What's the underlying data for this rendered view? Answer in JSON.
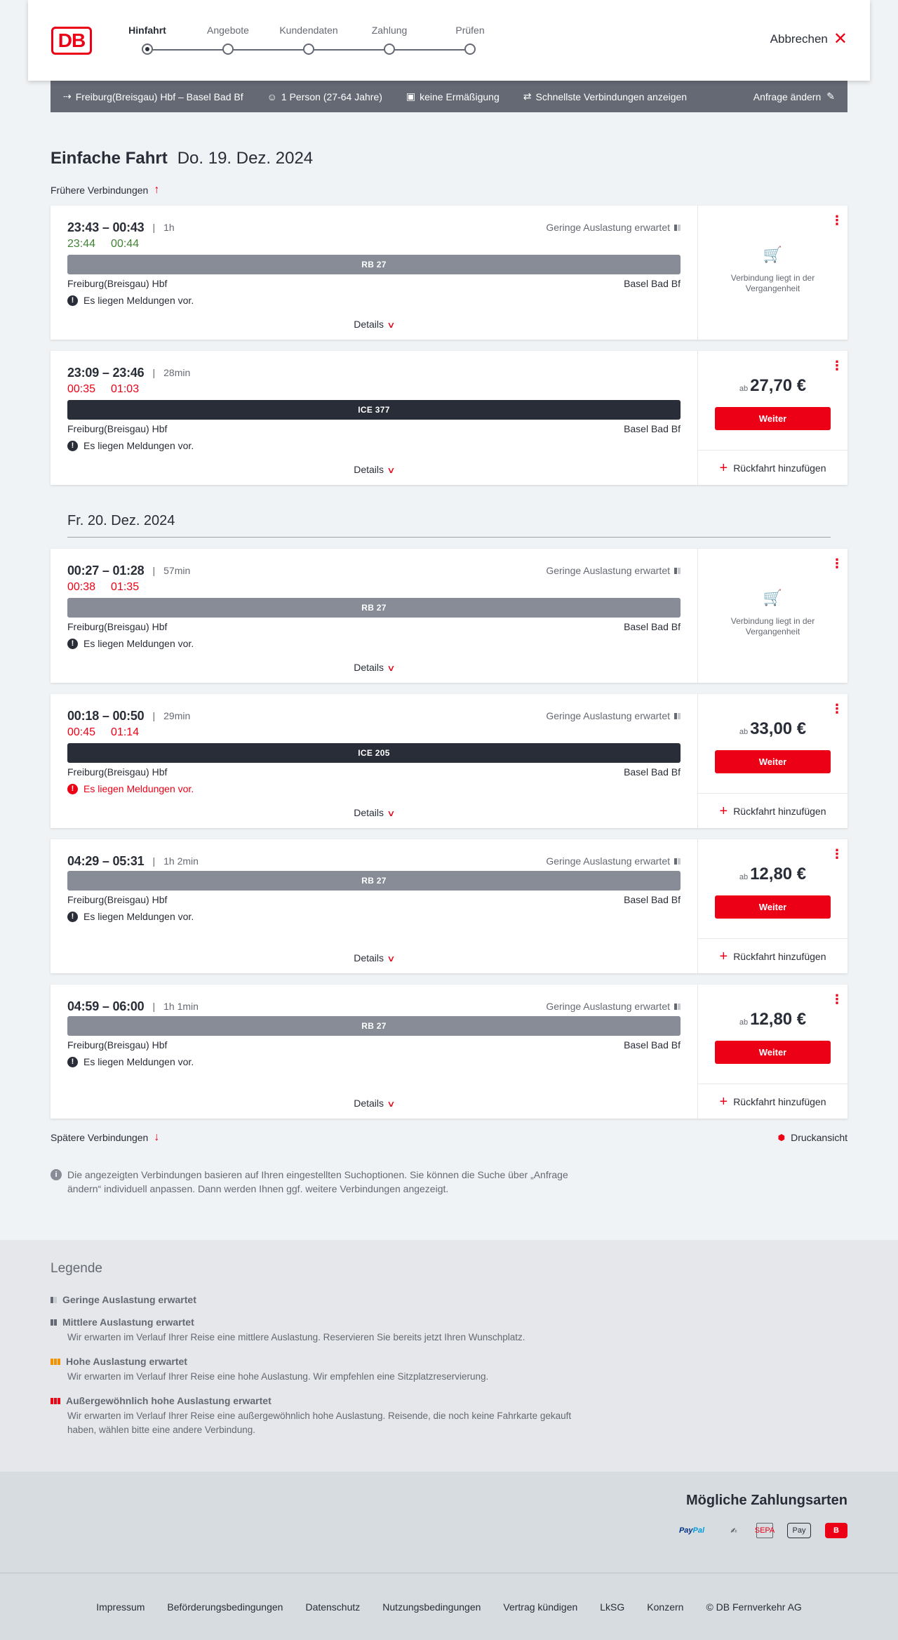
{
  "header": {
    "logo": "DB",
    "steps": [
      {
        "label": "Hinfahrt",
        "active": true
      },
      {
        "label": "Angebote",
        "active": false
      },
      {
        "label": "Kundendaten",
        "active": false
      },
      {
        "label": "Zahlung",
        "active": false
      },
      {
        "label": "Prüfen",
        "active": false
      }
    ],
    "cancel_label": "Abbrechen"
  },
  "query": {
    "route": "Freiburg(Breisgau) Hbf – Basel Bad Bf",
    "passengers": "1 Person (27-64 Jahre)",
    "discount": "keine Ermäßigung",
    "option": "Schnellste Verbindungen anzeigen",
    "change_label": "Anfrage ändern"
  },
  "page": {
    "trip_type": "Einfache Fahrt",
    "date": "Do. 19. Dez. 2024",
    "earlier_label": "Frühere Verbindungen",
    "later_label": "Spätere Verbindungen",
    "print_label": "Druckansicht",
    "date_separator": "Fr. 20. Dez. 2024",
    "info_text": "Die angezeigten Verbindungen basieren auf Ihren eingestellten Suchoptionen. Sie können die Suche über „Anfrage ändern“ individuell anpassen. Dann werden Ihnen ggf. weitere Verbindungen angezeigt."
  },
  "common": {
    "from": "Freiburg(Breisgau) Hbf",
    "to": "Basel Bad Bf",
    "message": "Es liegen Meldungen vor.",
    "details": "Details",
    "load_low": "Geringe Auslastung erwartet",
    "past_text": "Verbindung liegt in der Vergangenheit",
    "ab": "ab",
    "continue": "Weiter",
    "add_return": "Rückfahrt hinzufügen"
  },
  "connections": [
    {
      "times": "23:43 – 00:43",
      "duration": "1h",
      "rt_dep": "23:44",
      "rt_arr": "00:44",
      "rt_color": "green",
      "train": "RB 27",
      "train_type": "rb",
      "load": true,
      "message_red": false,
      "past": true,
      "price": ""
    },
    {
      "times": "23:09 – 23:46",
      "duration": "28min",
      "rt_dep": "00:35",
      "rt_arr": "01:03",
      "rt_color": "red",
      "train": "ICE 377",
      "train_type": "ice",
      "load": false,
      "message_red": false,
      "past": false,
      "price": "27,70 €"
    },
    {
      "times": "00:27 – 01:28",
      "duration": "57min",
      "rt_dep": "00:38",
      "rt_arr": "01:35",
      "rt_color": "red",
      "train": "RB 27",
      "train_type": "rb",
      "load": true,
      "message_red": false,
      "past": true,
      "price": ""
    },
    {
      "times": "00:18 – 00:50",
      "duration": "29min",
      "rt_dep": "00:45",
      "rt_arr": "01:14",
      "rt_color": "red",
      "train": "ICE 205",
      "train_type": "ice",
      "load": true,
      "message_red": true,
      "past": false,
      "price": "33,00 €"
    },
    {
      "times": "04:29 – 05:31",
      "duration": "1h 2min",
      "rt_dep": "",
      "rt_arr": "",
      "rt_color": "",
      "train": "RB 27",
      "train_type": "rb",
      "load": true,
      "message_red": false,
      "past": false,
      "price": "12,80 €"
    },
    {
      "times": "04:59 – 06:00",
      "duration": "1h 1min",
      "rt_dep": "",
      "rt_arr": "",
      "rt_color": "",
      "train": "RB 27",
      "train_type": "rb",
      "load": true,
      "message_red": false,
      "past": false,
      "price": "12,80 €"
    }
  ],
  "legend": {
    "title": "Legende",
    "items": [
      {
        "title": "Geringe Auslastung erwartet",
        "desc": "",
        "level": "low"
      },
      {
        "title": "Mittlere Auslastung erwartet",
        "desc": "Wir erwarten im Verlauf Ihrer Reise eine mittlere Auslastung. Reservieren Sie bereits jetzt Ihren Wunschplatz.",
        "level": "medium"
      },
      {
        "title": "Hohe Auslastung erwartet",
        "desc": "Wir erwarten im Verlauf Ihrer Reise eine hohe Auslastung. Wir empfehlen eine Sitzplatzreservierung.",
        "level": "high"
      },
      {
        "title": "Außergewöhnlich hohe Auslastung erwartet",
        "desc": "Wir erwarten im Verlauf Ihrer Reise eine außergewöhnlich hohe Auslastung. Reisende, die noch keine Fahrkarte gekauft haben, wählen bitte eine andere Verbindung.",
        "level": "very-high"
      }
    ]
  },
  "payment": {
    "title": "Mögliche Zahlungsarten",
    "paypal_a": "Pay",
    "paypal_b": "Pal",
    "sepa": "SEPA",
    "apple": "Pay",
    "dbb": "B"
  },
  "footer": {
    "links": [
      "Impressum",
      "Beförderungsbedingungen",
      "Datenschutz",
      "Nutzungsbedingungen",
      "Vertrag kündigen",
      "LkSG",
      "Konzern",
      "© DB Fernverkehr AG"
    ]
  },
  "colors": {
    "brand_red": "#ec0016",
    "delay_red": "#ec0016",
    "ontime_green": "#408335",
    "querybar": "#646973"
  }
}
